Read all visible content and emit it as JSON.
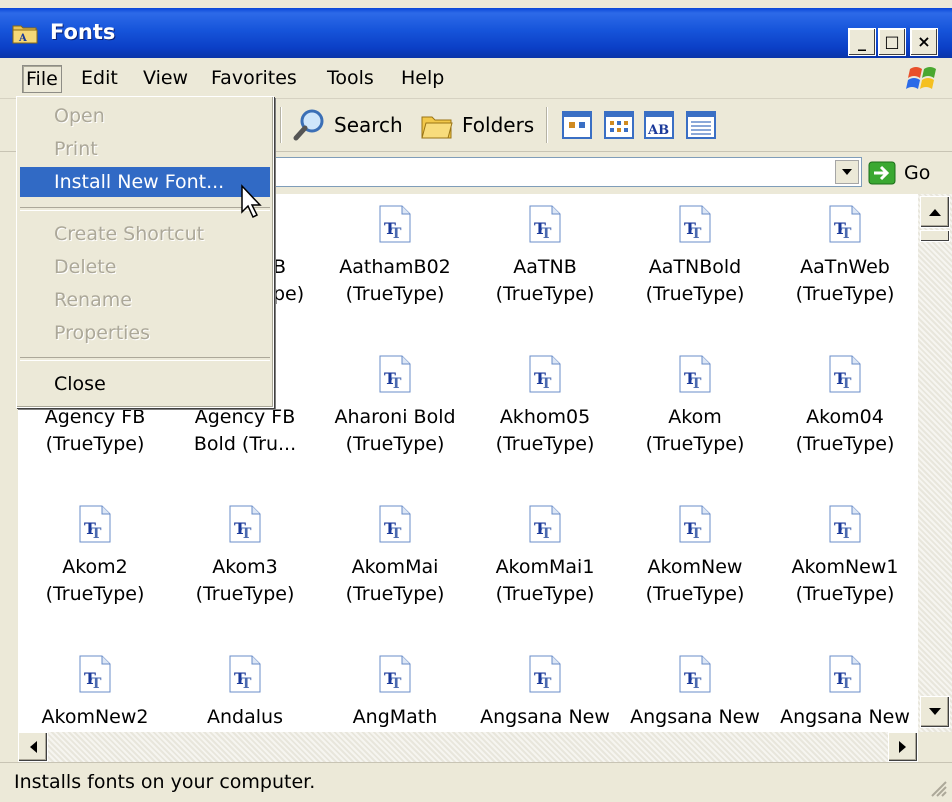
{
  "window": {
    "title": "Fonts",
    "caption_buttons": {
      "minimize": "_",
      "maximize": "□",
      "close": "×"
    }
  },
  "menubar": {
    "items": [
      {
        "label": "File"
      },
      {
        "label": "Edit"
      },
      {
        "label": "View"
      },
      {
        "label": "Favorites"
      },
      {
        "label": "Tools"
      },
      {
        "label": "Help"
      }
    ]
  },
  "toolbar": {
    "search_label": "Search",
    "folders_label": "Folders"
  },
  "addressbar": {
    "go_label": "Go"
  },
  "file_menu": {
    "items": [
      {
        "label": "Open",
        "enabled": false
      },
      {
        "label": "Print",
        "enabled": false
      },
      {
        "label": "Install New Font...",
        "enabled": true,
        "highlighted": true
      },
      {
        "label": "Create Shortcut",
        "enabled": false
      },
      {
        "label": "Delete",
        "enabled": false
      },
      {
        "label": "Rename",
        "enabled": false
      },
      {
        "label": "Properties",
        "enabled": false
      },
      {
        "label": "Close",
        "enabled": true
      }
    ]
  },
  "fonts": {
    "row1": [
      {
        "name": "B",
        "type": "pe)"
      },
      {
        "name": "AathamB02",
        "type": "(TrueType)"
      },
      {
        "name": "AaTNB",
        "type": "(TrueType)"
      },
      {
        "name": "AaTNBold",
        "type": "(TrueType)"
      },
      {
        "name": "AaTnWeb",
        "type": "(TrueType)"
      }
    ],
    "row2": [
      {
        "name": "Agency FB",
        "type": "(TrueType)"
      },
      {
        "name": "Agency FB",
        "type": "Bold (Tru..."
      },
      {
        "name": "Aharoni Bold",
        "type": "(TrueType)"
      },
      {
        "name": "Akhom05",
        "type": "(TrueType)"
      },
      {
        "name": "Akom",
        "type": "(TrueType)"
      },
      {
        "name": "Akom04",
        "type": "(TrueType)"
      }
    ],
    "row3": [
      {
        "name": "Akom2",
        "type": "(TrueType)"
      },
      {
        "name": "Akom3",
        "type": "(TrueType)"
      },
      {
        "name": "AkomMai",
        "type": "(TrueType)"
      },
      {
        "name": "AkomMai1",
        "type": "(TrueType)"
      },
      {
        "name": "AkomNew",
        "type": "(TrueType)"
      },
      {
        "name": "AkomNew1",
        "type": "(TrueType)"
      }
    ],
    "row4": [
      {
        "name": "AkomNew2"
      },
      {
        "name": "Andalus"
      },
      {
        "name": "AngMath"
      },
      {
        "name": "Angsana New"
      },
      {
        "name": "Angsana New"
      },
      {
        "name": "Angsana New"
      }
    ]
  },
  "statusbar": {
    "text": "Installs fonts on your computer."
  }
}
